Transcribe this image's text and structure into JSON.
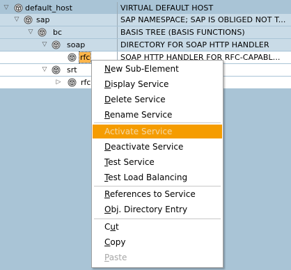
{
  "tree": {
    "rows": [
      {
        "label": "default_host",
        "description": "VIRTUAL DEFAULT HOST"
      },
      {
        "label": "sap",
        "description": "SAP NAMESPACE; SAP IS OBLIGED NOT T..."
      },
      {
        "label": "bc",
        "description": "BASIS TREE (BASIS FUNCTIONS)"
      },
      {
        "label": "soap",
        "description": "DIRECTORY FOR SOAP HTTP HANDLER"
      },
      {
        "label": "rfc",
        "description": "SOAP HTTP HANDLER FOR RFC-CAPABL..."
      },
      {
        "label": "srt",
        "description": ""
      },
      {
        "label": "rfc",
        "description": ""
      }
    ]
  },
  "context_menu": {
    "items": [
      {
        "prefix": "",
        "ul": "N",
        "rest": "ew Sub-Element",
        "state": "normal"
      },
      {
        "prefix": "",
        "ul": "D",
        "rest": "isplay Service",
        "state": "normal"
      },
      {
        "prefix": "",
        "ul": "D",
        "rest": "elete Service",
        "state": "normal"
      },
      {
        "prefix": "",
        "ul": "R",
        "rest": "ename Service",
        "state": "normal"
      },
      {
        "prefix": "",
        "ul": "",
        "rest": "Activate Service",
        "state": "highlighted"
      },
      {
        "prefix": "",
        "ul": "D",
        "rest": "eactivate Service",
        "state": "normal"
      },
      {
        "prefix": "",
        "ul": "T",
        "rest": "est Service",
        "state": "normal"
      },
      {
        "prefix": "",
        "ul": "T",
        "rest": "est Load Balancing",
        "state": "normal"
      },
      {
        "prefix": "",
        "ul": "R",
        "rest": "eferences to Service",
        "state": "normal"
      },
      {
        "prefix": "",
        "ul": "O",
        "rest": "bj. Directory Entry",
        "state": "normal"
      },
      {
        "prefix": "C",
        "ul": "u",
        "rest": "t",
        "state": "normal"
      },
      {
        "prefix": "",
        "ul": "C",
        "rest": "opy",
        "state": "normal"
      },
      {
        "prefix": "",
        "ul": "P",
        "rest": "aste",
        "state": "disabled"
      }
    ]
  },
  "colors": {
    "background": "#a9c4d6",
    "selected_row": "#c9dbe7",
    "menu_highlight": "#f59c00",
    "node_highlight": "#ffb54a"
  }
}
